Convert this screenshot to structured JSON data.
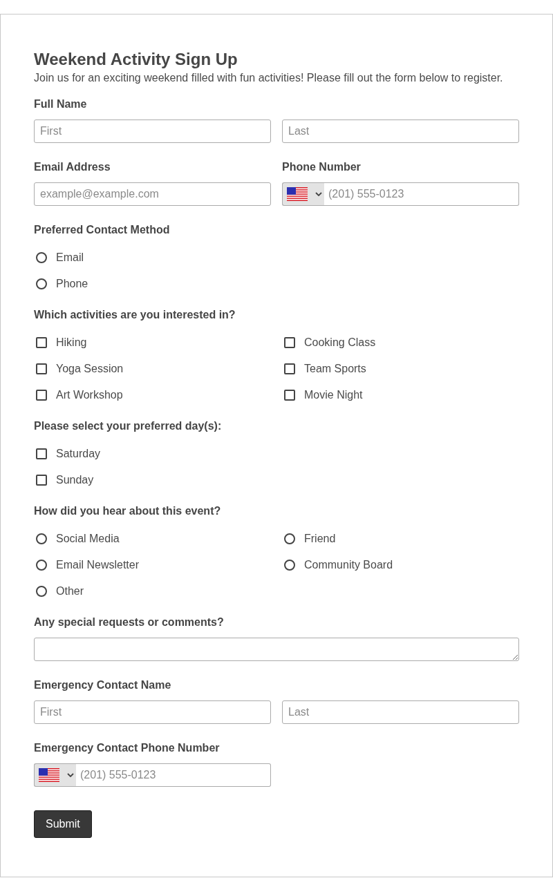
{
  "form": {
    "title": "Weekend Activity Sign Up",
    "description": "Join us for an exciting weekend filled with fun activities! Please fill out the form below to register."
  },
  "fields": [
    {
      "kind": "name",
      "label": "Full Name",
      "inputs": [
        {
          "placeholder": "First"
        },
        {
          "placeholder": "Last"
        }
      ]
    },
    {
      "kind": "email",
      "label": "Email Address",
      "placeholder": "example@example.com"
    },
    {
      "kind": "phone",
      "label": "Phone Number",
      "placeholder": "(201) 555-0123"
    },
    {
      "kind": "radio",
      "label": "Preferred Contact Method",
      "rows": [
        [
          {
            "label": "Email",
            "selected": false
          }
        ],
        [
          {
            "label": "Phone",
            "selected": false
          }
        ]
      ]
    },
    {
      "kind": "checkbox",
      "label": "Which activities are you interested in?",
      "rows": [
        [
          {
            "label": "Hiking",
            "checked": false
          },
          {
            "label": "Cooking Class",
            "checked": false
          }
        ],
        [
          {
            "label": "Yoga Session",
            "checked": false
          },
          {
            "label": "Team Sports",
            "checked": false
          }
        ],
        [
          {
            "label": "Art Workshop",
            "checked": false
          },
          {
            "label": "Movie Night",
            "checked": false
          }
        ]
      ]
    },
    {
      "kind": "checkbox",
      "label": "Please select your preferred day(s):",
      "rows": [
        [
          {
            "label": "Saturday",
            "checked": false
          }
        ],
        [
          {
            "label": "Sunday",
            "checked": false
          }
        ]
      ]
    },
    {
      "kind": "radio",
      "label": "How did you hear about this event?",
      "rows": [
        [
          {
            "label": "Social Media",
            "selected": false
          },
          {
            "label": "Friend",
            "selected": false
          }
        ],
        [
          {
            "label": "Email Newsletter",
            "selected": false
          },
          {
            "label": "Community Board",
            "selected": false
          }
        ],
        [
          {
            "label": "Other",
            "selected": false
          }
        ]
      ]
    },
    {
      "kind": "textarea",
      "label": "Any special requests or comments?"
    },
    {
      "kind": "name",
      "label": "Emergency Contact Name",
      "inputs": [
        {
          "placeholder": "First"
        },
        {
          "placeholder": "Last"
        }
      ]
    },
    {
      "kind": "phone",
      "label": "Emergency Contact Phone Number",
      "placeholder": "(201) 555-0123"
    }
  ],
  "submit": {
    "label": "Submit"
  }
}
